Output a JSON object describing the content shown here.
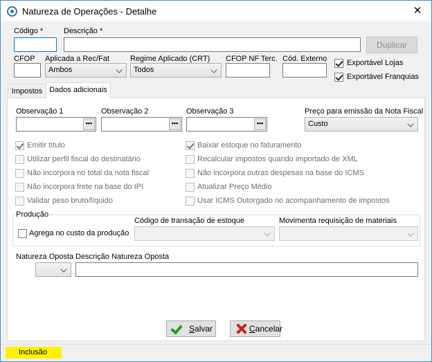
{
  "window": {
    "title": "Natureza de Operações - Detalhe",
    "close_glyph": "✕"
  },
  "header": {
    "codigo_label": "Código *",
    "codigo_value": "",
    "descricao_label": "Descrição *",
    "descricao_value": "",
    "duplicar_label": "Duplicar",
    "cfop_label": "CFOP",
    "cfop_value": "",
    "aplicada_label": "Aplicada a Rec/Fat",
    "aplicada_value": "Ambos",
    "regime_label": "Regime Aplicado (CRT)",
    "regime_value": "Todos",
    "cfop_nf_label": "CFOP NF Terc.",
    "cfop_nf_value": "",
    "cod_externo_label": "Cód. Externo",
    "cod_externo_value": "",
    "exportavel_lojas_label": "Exportável Lojas",
    "exportavel_lojas_checked": true,
    "exportavel_franquias_label": "Exportável Franquias",
    "exportavel_franquias_checked": true
  },
  "tabs": [
    {
      "label": "Impostos",
      "active": false
    },
    {
      "label": "Dados adicionais",
      "active": true
    }
  ],
  "dados": {
    "obs1_label": "Observação 1",
    "obs2_label": "Observação 2",
    "obs3_label": "Observação 3",
    "ellipsis": "•••",
    "preco_label": "Preço para emissão da Nota Fiscal",
    "preco_value": "Custo",
    "left_checks": [
      {
        "label": "Emitir título",
        "checked": true
      },
      {
        "label": "Utilizar perfil fiscal do destinatário",
        "checked": false
      },
      {
        "label": "Não incorpora no total da nota fiscal",
        "checked": false
      },
      {
        "label": "Não incorpora frete na base do IPI",
        "checked": false
      },
      {
        "label": "Validar peso bruto/líquido",
        "checked": false
      }
    ],
    "right_checks": [
      {
        "label": "Baixar estoque no faturamento",
        "checked": true
      },
      {
        "label": "Recalcular impostos quando importado de XML",
        "checked": false
      },
      {
        "label": "Não incorpora outras despesas na base do ICMS",
        "checked": false
      },
      {
        "label": "Atualizar Preço Médio",
        "checked": false
      },
      {
        "label": "Usar ICMS Outorgado no acompanhamento de impostos",
        "checked": false
      }
    ],
    "producao": {
      "title": "Produção",
      "agrega_label": "Agrega no custo da produção",
      "agrega_checked": false,
      "codigo_transacao_label": "Código de transação de estoque",
      "codigo_transacao_value": "",
      "movimenta_label": "Movimenta requisição de materiais",
      "movimenta_value": ""
    },
    "natureza_oposta_label": "Natureza Oposta",
    "natureza_oposta_value": "",
    "descricao_oposta_label": "Descrição Natureza Oposta",
    "descricao_oposta_value": ""
  },
  "footer": {
    "salvar_accel": "S",
    "salvar_rest": "alvar",
    "cancelar_accel": "C",
    "cancelar_rest": "ancelar"
  },
  "status": {
    "mode": "Inclusão",
    "badge_color": "#fff200"
  }
}
